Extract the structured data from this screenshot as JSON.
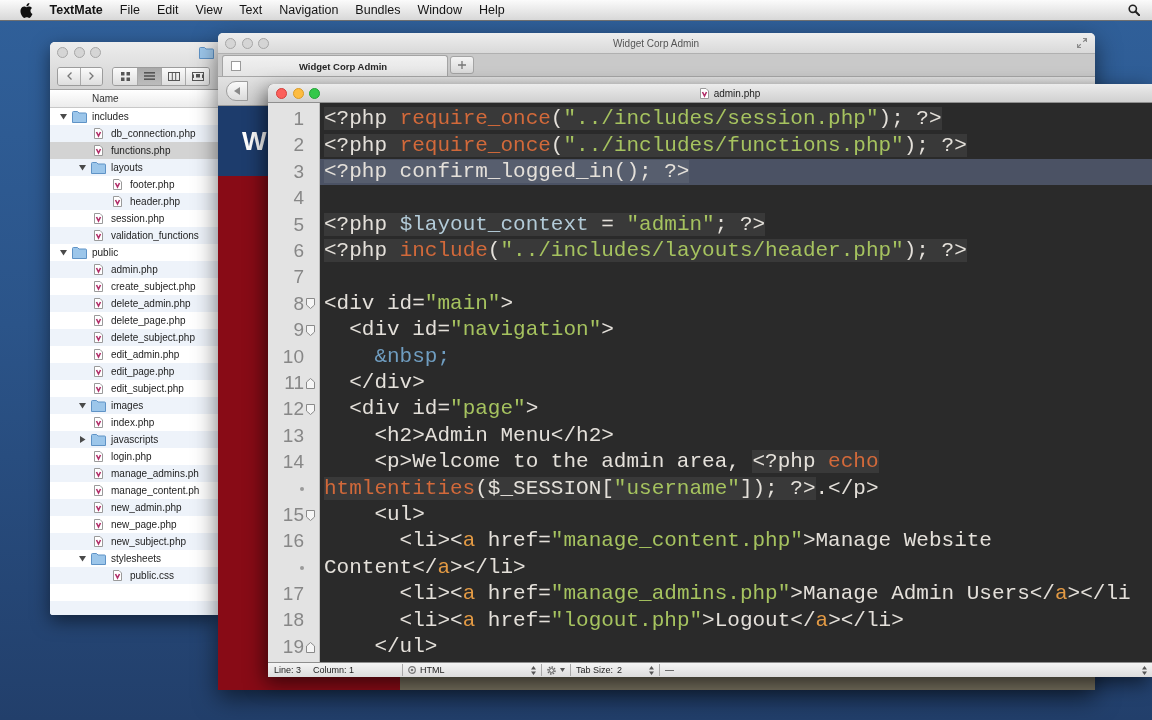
{
  "menu_bar": {
    "app_name": "TextMate",
    "items": [
      "File",
      "Edit",
      "View",
      "Text",
      "Navigation",
      "Bundles",
      "Window",
      "Help"
    ]
  },
  "finder_window": {
    "active": false,
    "view_modes": [
      {
        "kind": "icon",
        "selected": false
      },
      {
        "kind": "list",
        "selected": true
      },
      {
        "kind": "column",
        "selected": false
      },
      {
        "kind": "coverflow",
        "selected": false
      }
    ],
    "column_header": "Name",
    "items": [
      {
        "name": "includes",
        "kind": "folder",
        "expanded": true,
        "selected": false,
        "children": [
          {
            "name": "db_connection.php",
            "kind": "file",
            "selected": false
          },
          {
            "name": "functions.php",
            "kind": "file",
            "selected": true
          },
          {
            "name": "layouts",
            "kind": "folder",
            "expanded": true,
            "selected": false,
            "children": [
              {
                "name": "footer.php",
                "kind": "file",
                "selected": false
              },
              {
                "name": "header.php",
                "kind": "file",
                "selected": false
              }
            ]
          },
          {
            "name": "session.php",
            "kind": "file",
            "selected": false
          },
          {
            "name": "validation_functions",
            "kind": "file",
            "selected": false
          }
        ]
      },
      {
        "name": "public",
        "kind": "folder",
        "expanded": true,
        "selected": false,
        "children": [
          {
            "name": "admin.php",
            "kind": "file",
            "selected": false
          },
          {
            "name": "create_subject.php",
            "kind": "file",
            "selected": false
          },
          {
            "name": "delete_admin.php",
            "kind": "file",
            "selected": false
          },
          {
            "name": "delete_page.php",
            "kind": "file",
            "selected": false
          },
          {
            "name": "delete_subject.php",
            "kind": "file",
            "selected": false
          },
          {
            "name": "edit_admin.php",
            "kind": "file",
            "selected": false
          },
          {
            "name": "edit_page.php",
            "kind": "file",
            "selected": false
          },
          {
            "name": "edit_subject.php",
            "kind": "file",
            "selected": false
          },
          {
            "name": "images",
            "kind": "folder",
            "expanded": true,
            "selected": false
          },
          {
            "name": "index.php",
            "kind": "file",
            "selected": false
          },
          {
            "name": "javascripts",
            "kind": "folder",
            "expanded": false,
            "selected": false
          },
          {
            "name": "login.php",
            "kind": "file",
            "selected": false
          },
          {
            "name": "manage_admins.ph",
            "kind": "file",
            "selected": false
          },
          {
            "name": "manage_content.ph",
            "kind": "file",
            "selected": false
          },
          {
            "name": "new_admin.php",
            "kind": "file",
            "selected": false
          },
          {
            "name": "new_page.php",
            "kind": "file",
            "selected": false
          },
          {
            "name": "new_subject.php",
            "kind": "file",
            "selected": false
          },
          {
            "name": "stylesheets",
            "kind": "folder",
            "expanded": true,
            "selected": false,
            "children": [
              {
                "name": "public.css",
                "kind": "file",
                "selected": false
              }
            ]
          }
        ]
      }
    ]
  },
  "browser_window": {
    "active": false,
    "title": "Widget Corp Admin",
    "tabs": [
      {
        "label": "Widget Corp Admin",
        "selected": true
      }
    ],
    "page_header": "W"
  },
  "editor_window": {
    "active": true,
    "title": "admin.php",
    "lines": [
      {
        "number": "1",
        "current": false,
        "rows": [
          {
            "tokens": [
              {
                "text": "<?php ",
                "kind": "plain",
                "embedded": true
              },
              {
                "text": "require_once",
                "kind": "function",
                "embedded": true
              },
              {
                "text": "(",
                "kind": "plain",
                "embedded": true
              },
              {
                "text": "\"../includes/session.php\"",
                "kind": "string",
                "embedded": true
              },
              {
                "text": "); ?>",
                "kind": "plain",
                "embedded": true
              }
            ]
          }
        ]
      },
      {
        "number": "2",
        "current": false,
        "rows": [
          {
            "tokens": [
              {
                "text": "<?php ",
                "kind": "plain",
                "embedded": true
              },
              {
                "text": "require_once",
                "kind": "function",
                "embedded": true
              },
              {
                "text": "(",
                "kind": "plain",
                "embedded": true
              },
              {
                "text": "\"../includes/functions.php\"",
                "kind": "string",
                "embedded": true
              },
              {
                "text": "); ?>",
                "kind": "plain",
                "embedded": true
              }
            ]
          }
        ]
      },
      {
        "number": "3",
        "current": true,
        "rows": [
          {
            "tokens": [
              {
                "text": "<?php confirm_logged_in(); ?>",
                "kind": "plain",
                "embedded": true
              }
            ]
          }
        ]
      },
      {
        "number": "4",
        "current": false
      },
      {
        "number": "5",
        "current": false,
        "rows": [
          {
            "tokens": [
              {
                "text": "<?php ",
                "kind": "plain",
                "embedded": true
              },
              {
                "text": "$layout_context",
                "kind": "variable",
                "embedded": true
              },
              {
                "text": " = ",
                "kind": "plain",
                "embedded": true
              },
              {
                "text": "\"admin\"",
                "kind": "string",
                "embedded": true
              },
              {
                "text": "; ?>",
                "kind": "plain",
                "embedded": true
              }
            ]
          }
        ]
      },
      {
        "number": "6",
        "current": false,
        "rows": [
          {
            "tokens": [
              {
                "text": "<?php ",
                "kind": "plain",
                "embedded": true
              },
              {
                "text": "include",
                "kind": "function",
                "embedded": true
              },
              {
                "text": "(",
                "kind": "plain",
                "embedded": true
              },
              {
                "text": "\"../includes/layouts/header.php\"",
                "kind": "string",
                "embedded": true
              },
              {
                "text": "); ?>",
                "kind": "plain",
                "embedded": true
              }
            ]
          }
        ]
      },
      {
        "number": "7",
        "current": false
      },
      {
        "number": "8",
        "fold_marker": {
          "kind": "start"
        },
        "current": false,
        "rows": [
          {
            "tokens": [
              {
                "text": "<div id=",
                "kind": "plain",
                "embedded": false
              },
              {
                "text": "\"main\"",
                "kind": "string",
                "embedded": false
              },
              {
                "text": ">",
                "kind": "plain",
                "embedded": false
              }
            ]
          }
        ]
      },
      {
        "number": "9",
        "fold_marker": {
          "kind": "start"
        },
        "current": false,
        "rows": [
          {
            "tokens": [
              {
                "text": "  <div id=",
                "kind": "plain",
                "embedded": false
              },
              {
                "text": "\"navigation\"",
                "kind": "string",
                "embedded": false
              },
              {
                "text": ">",
                "kind": "plain",
                "embedded": false
              }
            ]
          }
        ]
      },
      {
        "number": "10",
        "current": false,
        "rows": [
          {
            "tokens": [
              {
                "text": "    &nbsp;",
                "kind": "entity",
                "embedded": false
              }
            ]
          }
        ]
      },
      {
        "number": "11",
        "fold_marker": {
          "kind": "end"
        },
        "current": false,
        "rows": [
          {
            "tokens": [
              {
                "text": "  </div>",
                "kind": "plain",
                "embedded": false
              }
            ]
          }
        ]
      },
      {
        "number": "12",
        "fold_marker": {
          "kind": "start"
        },
        "current": false,
        "rows": [
          {
            "tokens": [
              {
                "text": "  <div id=",
                "kind": "plain",
                "embedded": false
              },
              {
                "text": "\"page\"",
                "kind": "string",
                "embedded": false
              },
              {
                "text": ">",
                "kind": "plain",
                "embedded": false
              }
            ]
          }
        ]
      },
      {
        "number": "13",
        "current": false,
        "rows": [
          {
            "tokens": [
              {
                "text": "    <h2>Admin Menu</h2>",
                "kind": "plain",
                "embedded": false
              }
            ]
          }
        ]
      },
      {
        "number": "14",
        "current": false,
        "rows": [
          {
            "tokens": [
              {
                "text": "    <p>Welcome to the admin area, ",
                "kind": "plain",
                "embedded": false
              },
              {
                "text": "<?php ",
                "kind": "plain",
                "embedded": true
              },
              {
                "text": "echo",
                "kind": "function",
                "embedded": true
              }
            ]
          },
          {
            "tokens": [
              {
                "text": "htmlentities",
                "kind": "function",
                "embedded": true
              },
              {
                "text": "($_SESSION[",
                "kind": "plain",
                "embedded": true
              },
              {
                "text": "\"username\"",
                "kind": "string",
                "embedded": true
              },
              {
                "text": "]); ?>",
                "kind": "plain",
                "embedded": true
              },
              {
                "text": ".</p>",
                "kind": "plain",
                "embedded": false
              }
            ]
          }
        ]
      },
      {
        "number": "15",
        "fold_marker": {
          "kind": "start"
        },
        "current": false,
        "rows": [
          {
            "tokens": [
              {
                "text": "    <ul>",
                "kind": "plain",
                "embedded": false
              }
            ]
          }
        ]
      },
      {
        "number": "16",
        "current": false,
        "rows": [
          {
            "tokens": [
              {
                "text": "      <li><",
                "kind": "plain",
                "embedded": false
              },
              {
                "text": "a",
                "kind": "anchor_tag",
                "embedded": false
              },
              {
                "text": " href=",
                "kind": "plain",
                "embedded": false
              },
              {
                "text": "\"manage_content.php\"",
                "kind": "string",
                "embedded": false
              },
              {
                "text": ">Manage Website",
                "kind": "plain",
                "embedded": false
              }
            ]
          },
          {
            "tokens": [
              {
                "text": "Content</",
                "kind": "plain",
                "embedded": false
              },
              {
                "text": "a",
                "kind": "anchor_tag",
                "embedded": false
              },
              {
                "text": "></li>",
                "kind": "plain",
                "embedded": false
              }
            ]
          }
        ]
      },
      {
        "number": "17",
        "current": false,
        "rows": [
          {
            "tokens": [
              {
                "text": "      <li><",
                "kind": "plain",
                "embedded": false
              },
              {
                "text": "a",
                "kind": "anchor_tag",
                "embedded": false
              },
              {
                "text": " href=",
                "kind": "plain",
                "embedded": false
              },
              {
                "text": "\"manage_admins.php\"",
                "kind": "string",
                "embedded": false
              },
              {
                "text": ">Manage Admin Users</",
                "kind": "plain",
                "embedded": false
              },
              {
                "text": "a",
                "kind": "anchor_tag",
                "embedded": false
              },
              {
                "text": "></li",
                "kind": "plain",
                "embedded": false
              }
            ]
          }
        ]
      },
      {
        "number": "18",
        "current": false,
        "rows": [
          {
            "tokens": [
              {
                "text": "      <li><",
                "kind": "plain",
                "embedded": false
              },
              {
                "text": "a",
                "kind": "anchor_tag",
                "embedded": false
              },
              {
                "text": " href=",
                "kind": "plain",
                "embedded": false
              },
              {
                "text": "\"logout.php\"",
                "kind": "string",
                "embedded": false
              },
              {
                "text": ">Logout</",
                "kind": "plain",
                "embedded": false
              },
              {
                "text": "a",
                "kind": "anchor_tag",
                "embedded": false
              },
              {
                "text": "></li>",
                "kind": "plain",
                "embedded": false
              }
            ]
          }
        ]
      },
      {
        "number": "19",
        "fold_marker": {
          "kind": "end"
        },
        "current": false,
        "rows": [
          {
            "tokens": [
              {
                "text": "    </ul>",
                "kind": "plain",
                "embedded": false
              }
            ]
          }
        ]
      }
    ],
    "status_bar": {
      "line": "Line: 3",
      "column": "Column: 1",
      "language": "HTML",
      "tab_size_label": "Tab Size:",
      "tab_size": "2",
      "symbol": "—"
    }
  }
}
